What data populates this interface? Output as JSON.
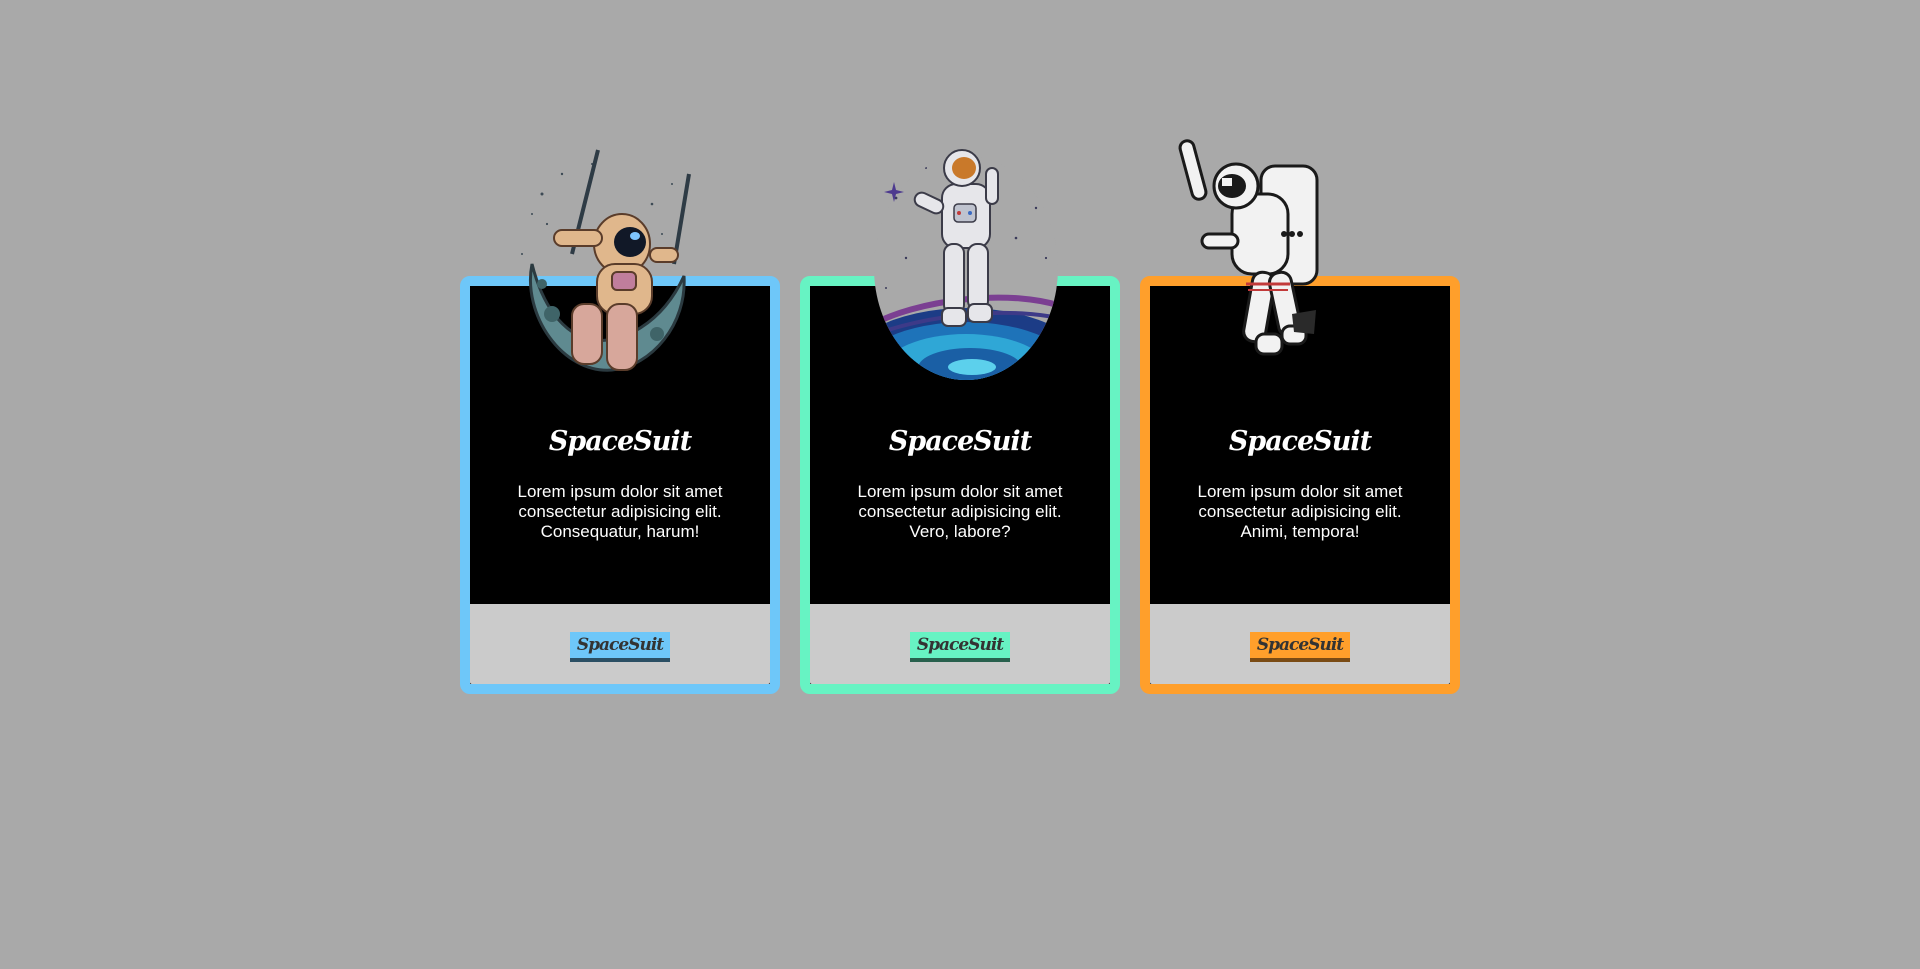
{
  "cards": [
    {
      "title": "SpaceSuit",
      "description": "Lorem ipsum dolor sit amet consectetur adipisicing elit. Consequatur, harum!",
      "button_label": "SpaceSuit",
      "accent_color": "#6ec7f9",
      "illustration": "astronaut-on-moon-swing-illustration"
    },
    {
      "title": "SpaceSuit",
      "description": "Lorem ipsum dolor sit amet consectetur adipisicing elit. Vero, labore?",
      "button_label": "SpaceSuit",
      "accent_color": "#67f3c3",
      "illustration": "astronaut-galaxy-illustration"
    },
    {
      "title": "SpaceSuit",
      "description": "Lorem ipsum dolor sit amet consectetur adipisicing elit. Animi, tempora!",
      "button_label": "SpaceSuit",
      "accent_color": "#ff9f2b",
      "illustration": "floating-astronaut-illustration"
    }
  ],
  "page": {
    "background_color": "#a9a9a9"
  }
}
